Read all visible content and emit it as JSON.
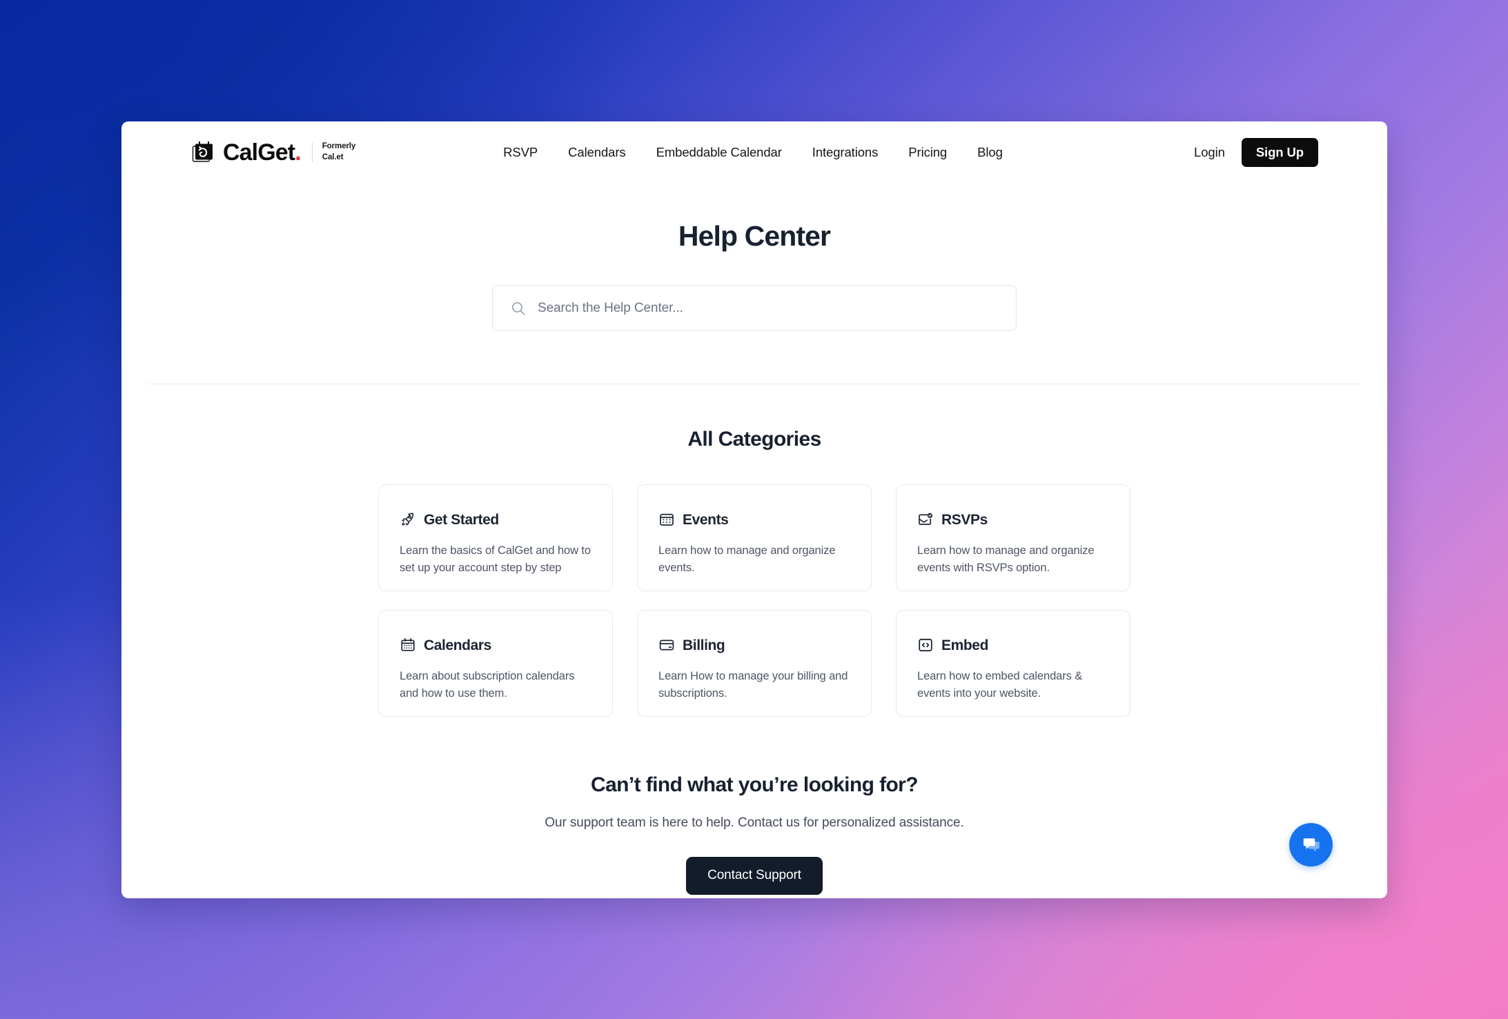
{
  "header": {
    "brand": {
      "wordmark": "CalGet",
      "wordmark_dot": ".",
      "formerly_line1": "Formerly",
      "formerly_line2": "Cal.et",
      "logo_icon": "calendar-logo-icon"
    },
    "nav": [
      {
        "label": "RSVP"
      },
      {
        "label": "Calendars"
      },
      {
        "label": "Embeddable Calendar"
      },
      {
        "label": "Integrations"
      },
      {
        "label": "Pricing"
      },
      {
        "label": "Blog"
      }
    ],
    "login_label": "Login",
    "signup_label": "Sign Up"
  },
  "hero": {
    "title": "Help Center",
    "search": {
      "placeholder": "Search the Help Center...",
      "value": "",
      "icon": "search-icon"
    }
  },
  "categories": {
    "title": "All Categories",
    "cards": [
      {
        "icon": "rocket-icon",
        "title": "Get Started",
        "desc": "Learn the basics of CalGet and how to set up your account step by step"
      },
      {
        "icon": "calendar-dots-icon",
        "title": "Events",
        "desc": "Learn how to manage and organize events."
      },
      {
        "icon": "envelope-check-icon",
        "title": "RSVPs",
        "desc": "Learn how to manage and organize events with RSVPs option."
      },
      {
        "icon": "calendar-icon",
        "title": "Calendars",
        "desc": "Learn about subscription calendars and how to use them."
      },
      {
        "icon": "credit-card-icon",
        "title": "Billing",
        "desc": "Learn How to manage your billing and subscriptions."
      },
      {
        "icon": "code-brackets-icon",
        "title": "Embed",
        "desc": "Learn how to embed calendars & events into your website."
      }
    ]
  },
  "cta": {
    "title": "Can’t find what you’re looking for?",
    "subtitle": "Our support team is here to help. Contact us for personalized assistance.",
    "button_label": "Contact Support"
  },
  "chat_widget": {
    "icon": "chat-bubbles-icon",
    "color": "#1673f0"
  },
  "theme": {
    "accent_dark": "#0c0c0e",
    "cta_dark": "#131c2b",
    "brand_dot_red": "#e8323c",
    "text_heading": "#18212f",
    "text_body": "#4d5563",
    "card_border": "#e7e9ed",
    "background_gradient_start": "#0a2ea0",
    "background_gradient_mid": "#9878e0",
    "background_gradient_end": "#f081c8"
  }
}
